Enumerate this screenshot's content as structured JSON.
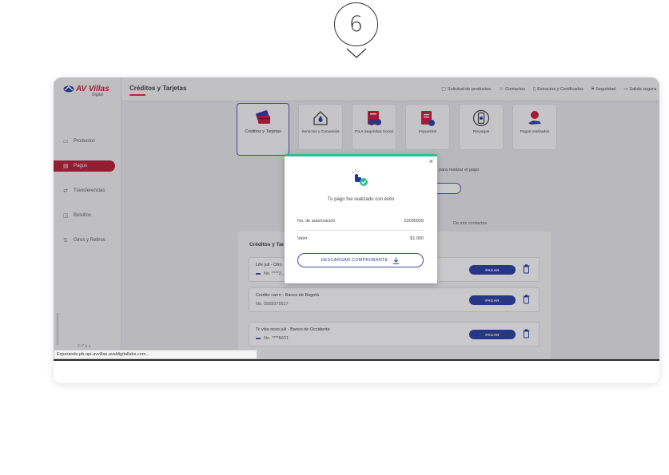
{
  "step": {
    "number": "6"
  },
  "app": {
    "logo": {
      "name": "AV Villas",
      "sub": "Digital"
    },
    "page_title": "Créditos y Tarjetas",
    "topnav": [
      {
        "label": "Solicitud de productos",
        "icon": "document-icon"
      },
      {
        "label": "Contactos",
        "icon": "contacts-icon"
      },
      {
        "label": "Extractos y Certificados",
        "icon": "file-icon"
      },
      {
        "label": "Seguridad",
        "icon": "lock-icon"
      },
      {
        "label": "Salida segura",
        "icon": "logout-icon"
      }
    ],
    "sidebar": {
      "items": [
        {
          "label": "Productos",
          "icon": "cards-icon",
          "active": false
        },
        {
          "label": "Pagos",
          "icon": "payment-icon",
          "active": true
        },
        {
          "label": "Transferencias",
          "icon": "transfer-icon",
          "active": false
        },
        {
          "label": "Bolsillos",
          "icon": "pocket-icon",
          "active": false
        },
        {
          "label": "Giros y Retiros",
          "icon": "withdraw-icon",
          "active": false
        }
      ],
      "footer": "2 i7 b a"
    },
    "tiles": [
      {
        "label": "Créditos y Tarjetas",
        "icon": "credit-cards-icon",
        "selected": true
      },
      {
        "label": "Servicios y Convenios",
        "icon": "house-drop-icon",
        "selected": false
      },
      {
        "label": "PILA Seguridad Social",
        "icon": "social-security-icon",
        "selected": false
      },
      {
        "label": "Impuestos",
        "icon": "taxes-icon",
        "selected": false
      },
      {
        "label": "Recargas",
        "icon": "phone-topup-icon",
        "selected": false
      },
      {
        "label": "Pagos realizados",
        "icon": "payments-done-icon",
        "selected": false
      }
    ],
    "hint": "para realizar el pago",
    "tab_label": "De mis contactos",
    "panel_title": "Créditos y Tar",
    "items": [
      {
        "name": "Life juli - Otro",
        "number": "No. ****3...",
        "pay_label": "PAGAR"
      },
      {
        "name": "Credito carro - Banco de Bogotá",
        "number": "No. 5565075517",
        "pay_label": "PAGAR"
      },
      {
        "name": "Tc visa ocso juli - Banco de Occidente",
        "number": "No. ****5631",
        "pay_label": "PAGAR"
      }
    ],
    "status_bar": "Esperando pb-api-avvillas.avaldigitallabs.com...",
    "colors": {
      "brand_red": "#c8102e",
      "primary_blue": "#1f35a0",
      "success_green": "#2fbf8e"
    }
  },
  "modal": {
    "close_label": "×",
    "message": "Tu pago fue realizado con éxito",
    "rows": [
      {
        "label": "No. de autorización",
        "value": "52090029"
      },
      {
        "label": "Valor",
        "value": "$1.000"
      }
    ],
    "download_label": "DESCARGAR COMPROBANTE"
  }
}
